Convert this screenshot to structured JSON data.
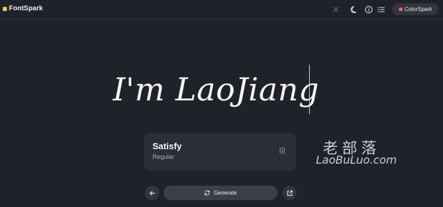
{
  "app": {
    "name": "FontSpark",
    "brand_color": "#f6c945"
  },
  "header": {
    "icons": [
      "close-icon",
      "moon-icon",
      "info-icon",
      "list-icon"
    ],
    "colorspark_label": "ColorSpark",
    "colorspark_color": "#ff5e50"
  },
  "preview": {
    "text": "I'm LaoJiang"
  },
  "font_card": {
    "name": "Satisfy",
    "style": "Regular",
    "icon": "sliders-icon"
  },
  "watermark": {
    "cn": "老部落",
    "en": "LaoBuLuo.com"
  },
  "controls": {
    "back_icon": "arrow-left-icon",
    "generate_label": "Generate",
    "generate_icon": "refresh-icon",
    "open_icon": "external-link-icon"
  }
}
